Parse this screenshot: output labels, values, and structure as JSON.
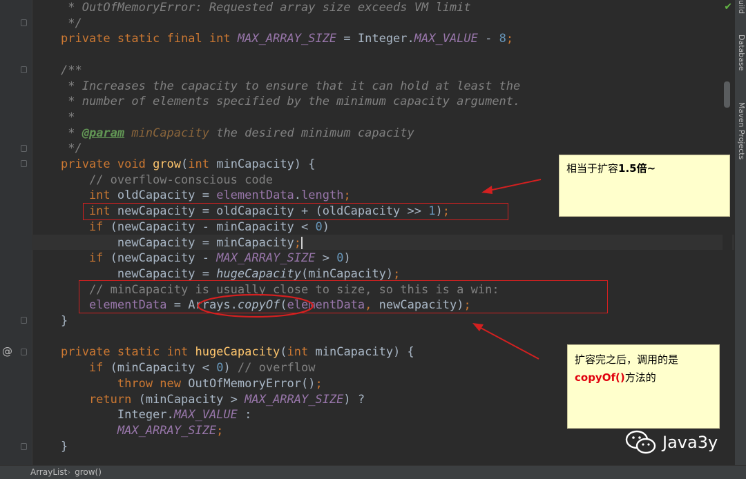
{
  "editor": {
    "lines": [
      {
        "segs": [
          [
            "cm",
            " * OutOfMemoryError: Requested array size exceeds VM limit"
          ]
        ]
      },
      {
        "segs": [
          [
            "cm",
            " */"
          ]
        ]
      },
      {
        "segs": [
          [
            "kw",
            "private static final int "
          ],
          [
            "cst",
            "MAX_ARRAY_SIZE"
          ],
          [
            "",
            " = Integer."
          ],
          [
            "cst",
            "MAX_VALUE"
          ],
          [
            "",
            " - "
          ],
          [
            "num",
            "8"
          ],
          [
            "kw",
            ";"
          ]
        ]
      },
      {
        "segs": []
      },
      {
        "segs": [
          [
            "cm",
            "/**"
          ]
        ]
      },
      {
        "segs": [
          [
            "cm",
            " * Increases the capacity to ensure that it can hold at least the"
          ]
        ]
      },
      {
        "segs": [
          [
            "cm",
            " * number of elements specified by the minimum capacity argument."
          ]
        ]
      },
      {
        "segs": [
          [
            "cm",
            " *"
          ]
        ]
      },
      {
        "segs": [
          [
            "cm",
            " * "
          ],
          [
            "tag",
            "@param"
          ],
          [
            "pname",
            " minCapacity"
          ],
          [
            "cm",
            " the desired minimum capacity"
          ]
        ]
      },
      {
        "segs": [
          [
            "cm",
            " */"
          ]
        ]
      },
      {
        "segs": [
          [
            "kw",
            "private void "
          ],
          [
            "fn",
            "grow"
          ],
          [
            "",
            "("
          ],
          [
            "kw",
            "int "
          ],
          [
            "",
            "minCapacity) {"
          ]
        ]
      },
      {
        "segs": [
          [
            "lc",
            "    // overflow-conscious code"
          ]
        ]
      },
      {
        "segs": [
          [
            "kw",
            "    int "
          ],
          [
            "",
            "oldCapacity = "
          ],
          [
            "fld",
            "elementData"
          ],
          [
            "",
            "."
          ],
          [
            "fld",
            "length"
          ],
          [
            "kw",
            ";"
          ]
        ]
      },
      {
        "segs": [
          [
            "kw",
            "    int "
          ],
          [
            "",
            "newCapacity = oldCapacity + (oldCapacity >> "
          ],
          [
            "num",
            "1"
          ],
          [
            "",
            ")"
          ],
          [
            "kw",
            ";"
          ]
        ]
      },
      {
        "segs": [
          [
            "kw",
            "    if "
          ],
          [
            "",
            "(newCapacity - minCapacity < "
          ],
          [
            "num",
            "0"
          ],
          [
            "",
            ")"
          ]
        ]
      },
      {
        "segs": [
          [
            "",
            "        newCapacity = minCapacity"
          ],
          [
            "kw",
            ";"
          ]
        ],
        "caret": true
      },
      {
        "segs": [
          [
            "kw",
            "    if "
          ],
          [
            "",
            "(newCapacity - "
          ],
          [
            "cst",
            "MAX_ARRAY_SIZE"
          ],
          [
            "",
            " > "
          ],
          [
            "num",
            "0"
          ],
          [
            "",
            ")"
          ]
        ]
      },
      {
        "segs": [
          [
            "",
            "        newCapacity = "
          ],
          [
            "it",
            "hugeCapacity"
          ],
          [
            "",
            "(minCapacity)"
          ],
          [
            "kw",
            ";"
          ]
        ]
      },
      {
        "segs": [
          [
            "lc",
            "    // minCapacity is usually close to size, so this is a win:"
          ]
        ]
      },
      {
        "segs": [
          [
            "fld",
            "    elementData"
          ],
          [
            "",
            " = Arrays."
          ],
          [
            "it",
            "copyOf"
          ],
          [
            "",
            "("
          ],
          [
            "fld",
            "elementData"
          ],
          [
            "kw",
            ", "
          ],
          [
            "",
            "newCapacity)"
          ],
          [
            "kw",
            ";"
          ]
        ]
      },
      {
        "segs": [
          [
            "",
            "}"
          ]
        ]
      },
      {
        "segs": []
      },
      {
        "segs": [
          [
            "kw",
            "private static int "
          ],
          [
            "fn",
            "hugeCapacity"
          ],
          [
            "",
            "("
          ],
          [
            "kw",
            "int "
          ],
          [
            "",
            "minCapacity) {"
          ]
        ]
      },
      {
        "segs": [
          [
            "kw",
            "    if "
          ],
          [
            "",
            "(minCapacity < "
          ],
          [
            "num",
            "0"
          ],
          [
            "",
            ") "
          ],
          [
            "lc",
            "// overflow"
          ]
        ]
      },
      {
        "segs": [
          [
            "kw",
            "        throw new "
          ],
          [
            "",
            "OutOfMemoryError()"
          ],
          [
            "kw",
            ";"
          ]
        ]
      },
      {
        "segs": [
          [
            "kw",
            "    return "
          ],
          [
            "",
            "(minCapacity > "
          ],
          [
            "cst",
            "MAX_ARRAY_SIZE"
          ],
          [
            "",
            ") ?"
          ]
        ]
      },
      {
        "segs": [
          [
            "",
            "        Integer."
          ],
          [
            "cst",
            "MAX_VALUE"
          ],
          [
            "",
            " :"
          ]
        ]
      },
      {
        "segs": [
          [
            "cst",
            "        MAX_ARRAY_SIZE"
          ],
          [
            "kw",
            ";"
          ]
        ]
      },
      {
        "segs": [
          [
            "",
            "}"
          ]
        ]
      }
    ]
  },
  "right_panel": {
    "tab_top": "uild",
    "tab_database": "Database",
    "tab_maven": "Maven Projects"
  },
  "status": {
    "crumb_class": "ArrayList",
    "crumb_method": "grow()"
  },
  "note1": {
    "text_pre": "相当于扩容",
    "text_bold": "1.5倍~"
  },
  "note2": {
    "line1": "扩容完之后，调用的是",
    "red": "copyOf()",
    "tail": "方法的"
  },
  "watermark": {
    "text": "Java3y"
  },
  "colors": {
    "annotation_red": "#d32020",
    "note_bg": "#ffffcc",
    "editor_bg": "#2b2b2b"
  }
}
